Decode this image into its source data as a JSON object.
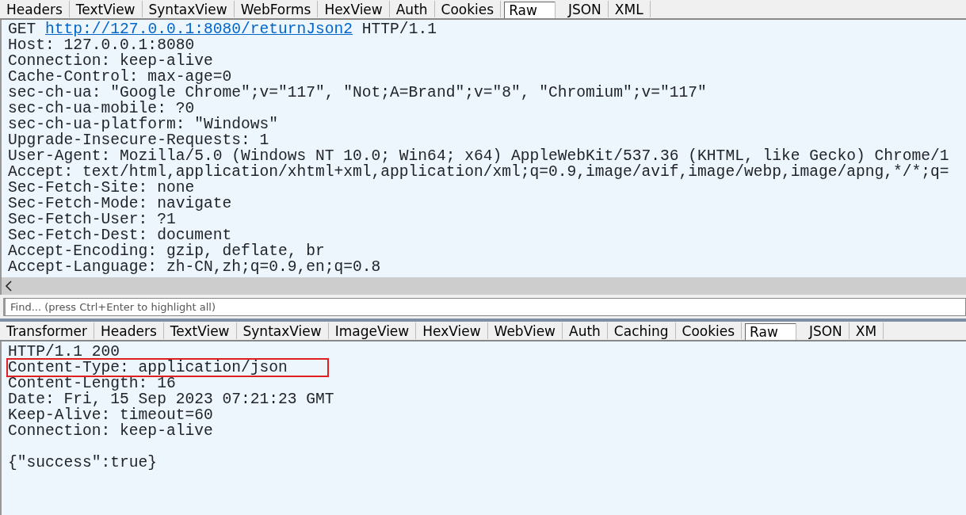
{
  "request": {
    "tabs": [
      {
        "label": "Headers",
        "selected": false
      },
      {
        "label": "TextView",
        "selected": false
      },
      {
        "label": "SyntaxView",
        "selected": false
      },
      {
        "label": "WebForms",
        "selected": false
      },
      {
        "label": "HexView",
        "selected": false
      },
      {
        "label": "Auth",
        "selected": false
      },
      {
        "label": "Cookies",
        "selected": false
      },
      {
        "label": "Raw",
        "selected": true
      },
      {
        "label": "JSON",
        "selected": false
      },
      {
        "label": "XML",
        "selected": false
      }
    ],
    "first_line": {
      "method": "GET",
      "url": "http://127.0.0.1:8080/returnJson2",
      "version": "HTTP/1.1"
    },
    "lines": [
      "Host: 127.0.0.1:8080",
      "Connection: keep-alive",
      "Cache-Control: max-age=0",
      "sec-ch-ua: \"Google Chrome\";v=\"117\", \"Not;A=Brand\";v=\"8\", \"Chromium\";v=\"117\"",
      "sec-ch-ua-mobile: ?0",
      "sec-ch-ua-platform: \"Windows\"",
      "Upgrade-Insecure-Requests: 1",
      "User-Agent: Mozilla/5.0 (Windows NT 10.0; Win64; x64) AppleWebKit/537.36 (KHTML, like Gecko) Chrome/1",
      "Accept: text/html,application/xhtml+xml,application/xml;q=0.9,image/avif,image/webp,image/apng,*/*;q=",
      "Sec-Fetch-Site: none",
      "Sec-Fetch-Mode: navigate",
      "Sec-Fetch-User: ?1",
      "Sec-Fetch-Dest: document",
      "Accept-Encoding: gzip, deflate, br",
      "Accept-Language: zh-CN,zh;q=0.9,en;q=0.8"
    ]
  },
  "find": {
    "placeholder": "Find... (press Ctrl+Enter to highlight all)"
  },
  "response": {
    "tabs": [
      {
        "label": "Transformer",
        "selected": false
      },
      {
        "label": "Headers",
        "selected": false
      },
      {
        "label": "TextView",
        "selected": false
      },
      {
        "label": "SyntaxView",
        "selected": false
      },
      {
        "label": "ImageView",
        "selected": false
      },
      {
        "label": "HexView",
        "selected": false
      },
      {
        "label": "WebView",
        "selected": false
      },
      {
        "label": "Auth",
        "selected": false
      },
      {
        "label": "Caching",
        "selected": false
      },
      {
        "label": "Cookies",
        "selected": false
      },
      {
        "label": "Raw",
        "selected": true
      },
      {
        "label": "JSON",
        "selected": false
      },
      {
        "label": "XM",
        "selected": false
      }
    ],
    "lines": [
      {
        "text": "HTTP/1.1 200",
        "highlighted": false
      },
      {
        "text": "Content-Type: application/json",
        "highlighted": true
      },
      {
        "text": "Content-Length: 16",
        "highlighted": false
      },
      {
        "text": "Date: Fri, 15 Sep 2023 07:21:23 GMT",
        "highlighted": false
      },
      {
        "text": "Keep-Alive: timeout=60",
        "highlighted": false
      },
      {
        "text": "Connection: keep-alive",
        "highlighted": false
      }
    ],
    "body": "{\"success\":true}"
  }
}
